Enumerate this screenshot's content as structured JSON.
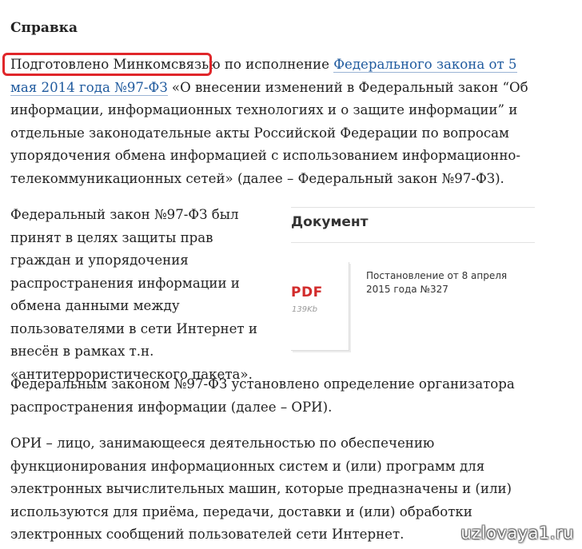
{
  "section": {
    "heading": "Справка"
  },
  "paragraphs": {
    "p1_before": "Подготовлено Минкомсвязью по исполнение ",
    "p1_link": "Федерального закона от 5 мая 2014 года №97-ФЗ",
    "p1_after": " «О внесении изменений в Федеральный закон “Об информации, информационных технологиях и о защите информации” и отдельные законодательные акты Российской Федерации по вопросам упорядочения обмена информацией с использованием информационно-телекоммуникационных сетей» (далее – Федеральный закон №97-ФЗ).",
    "p2": "Федеральный закон №97-ФЗ был принят в целях защиты прав граждан и упорядочения распространения информации и обмена данными между пользователями в сети Интернет и внесён в рамках т.н. «антитеррористического пакета».",
    "p3": "Федеральным законом №97-ФЗ установлено определение организатора распространения информации (далее – ОРИ).",
    "p4": "ОРИ – лицо, занимающееся деятельностью по обеспечению функционирования информационных систем и (или) программ для электронных вычислительных машин, которые предназначены и (или) используются для приёма, передачи, доставки и (или) обработки электронных сообщений пользователей сети Интернет."
  },
  "document_box": {
    "title": "Документ",
    "file_type": "PDF",
    "file_size": "139Kb",
    "description": "Постановление от 8 апреля 2015 года №327"
  },
  "watermark": {
    "text": "uzlovaya1.ru"
  },
  "colors": {
    "link": "#1f5a9e",
    "highlight_border": "#e0262a",
    "pdf_label": "#d22c2c"
  }
}
